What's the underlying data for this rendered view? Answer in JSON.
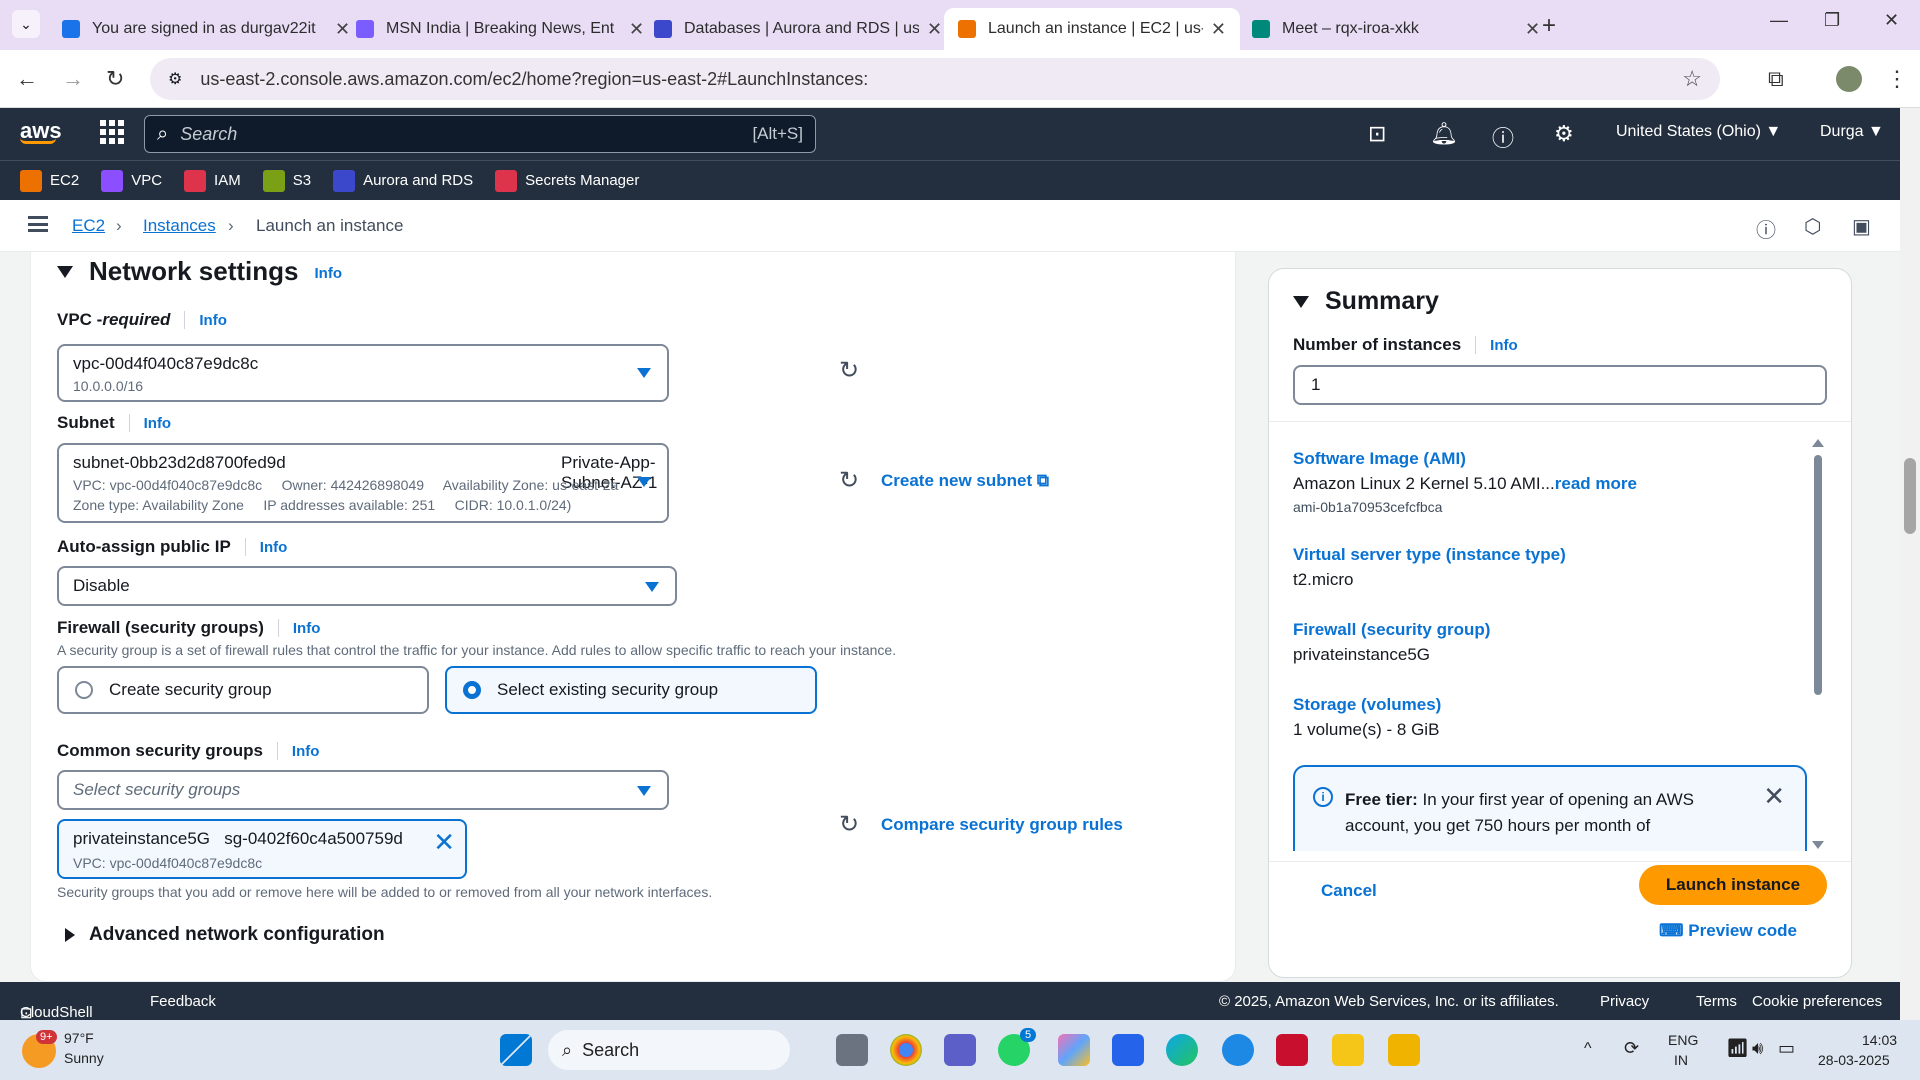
{
  "browser": {
    "tabs": [
      {
        "title": "You are signed in as durgav22it",
        "color": "#1a73e8"
      },
      {
        "title": "MSN India | Breaking News, Ent",
        "color": "#7b5cff"
      },
      {
        "title": "Databases | Aurora and RDS | us",
        "color": "#3b48cc"
      },
      {
        "title": "Launch an instance | EC2 | us-ea",
        "color": "#ed7100"
      },
      {
        "title": "Meet – rqx-iroa-xkk",
        "color": "#00897b"
      }
    ],
    "url": "us-east-2.console.aws.amazon.com/ec2/home?region=us-east-2#LaunchInstances:"
  },
  "aws": {
    "logo": "aws",
    "search_placeholder": "Search",
    "search_shortcut": "[Alt+S]",
    "region": "United States (Ohio) ▼",
    "user": "Durga ▼",
    "favorites": [
      {
        "label": "EC2",
        "color": "#ed7100"
      },
      {
        "label": "VPC",
        "color": "#8c4fff"
      },
      {
        "label": "IAM",
        "color": "#dd344c"
      },
      {
        "label": "S3",
        "color": "#7aa116"
      },
      {
        "label": "Aurora and RDS",
        "color": "#3b48cc"
      },
      {
        "label": "Secrets Manager",
        "color": "#dd344c"
      }
    ]
  },
  "breadcrumb": {
    "ec2": "EC2",
    "instances": "Instances",
    "current": "Launch an instance"
  },
  "network": {
    "title": "Network settings",
    "info": "Info",
    "vpc_label": "VPC - ",
    "vpc_required": "required",
    "vpc_value": "vpc-00d4f040c87e9dc8c",
    "vpc_cidr": "10.0.0.0/16",
    "subnet_label": "Subnet",
    "subnet_id": "subnet-0bb23d2d8700fed9d",
    "subnet_name": "Private-App-Subnet-AZ-1",
    "subnet_line2": "VPC: vpc-00d4f040c87e9dc8c     Owner: 442426898049     Availability Zone: us-east-2a",
    "subnet_line3": "Zone type: Availability Zone     IP addresses available: 251     CIDR: 10.0.1.0/24)",
    "create_subnet": "Create new subnet",
    "auto_ip_label": "Auto-assign public IP",
    "auto_ip_value": "Disable",
    "firewall_label": "Firewall (security groups)",
    "firewall_desc": "A security group is a set of firewall rules that control the traffic for your instance. Add rules to allow specific traffic to reach your instance.",
    "radio_create": "Create security group",
    "radio_select": "Select existing security group",
    "common_sg_label": "Common security groups",
    "sg_placeholder": "Select security groups",
    "compare_rules": "Compare security group rules",
    "token_name": "privateinstance5G",
    "token_id": "sg-0402f60c4a500759d",
    "token_vpc": "VPC: vpc-00d4f040c87e9dc8c",
    "sg_note": "Security groups that you add or remove here will be added to or removed from all your network interfaces.",
    "advanced": "Advanced network configuration"
  },
  "summary": {
    "title": "Summary",
    "num_label": "Number of instances",
    "info": "Info",
    "num_value": "1",
    "ami_key": "Software Image (AMI)",
    "ami_val": "Amazon Linux 2 Kernel 5.10 AMI...",
    "read_more": "read more",
    "ami_id": "ami-0b1a70953cefcfbca",
    "type_key": "Virtual server type (instance type)",
    "type_val": "t2.micro",
    "fw_key": "Firewall (security group)",
    "fw_val": "privateinstance5G",
    "storage_key": "Storage (volumes)",
    "storage_val": "1 volume(s) - 8 GiB",
    "free_tier_bold": "Free tier:",
    "free_tier_text": " In your first year of opening an AWS account, you get 750 hours per month of",
    "cancel": "Cancel",
    "launch": "Launch instance",
    "preview": "Preview code"
  },
  "footer": {
    "cloudshell": "CloudShell",
    "feedback": "Feedback",
    "copyright": "© 2025, Amazon Web Services, Inc. or its affiliates.",
    "privacy": "Privacy",
    "terms": "Terms",
    "cookies": "Cookie preferences"
  },
  "taskbar": {
    "temp": "97°F",
    "weather": "Sunny",
    "weather_badge": "9+",
    "search": "Search",
    "lang1": "ENG",
    "lang2": "IN",
    "time": "14:03",
    "date": "28-03-2025",
    "teams_badge": "5"
  }
}
